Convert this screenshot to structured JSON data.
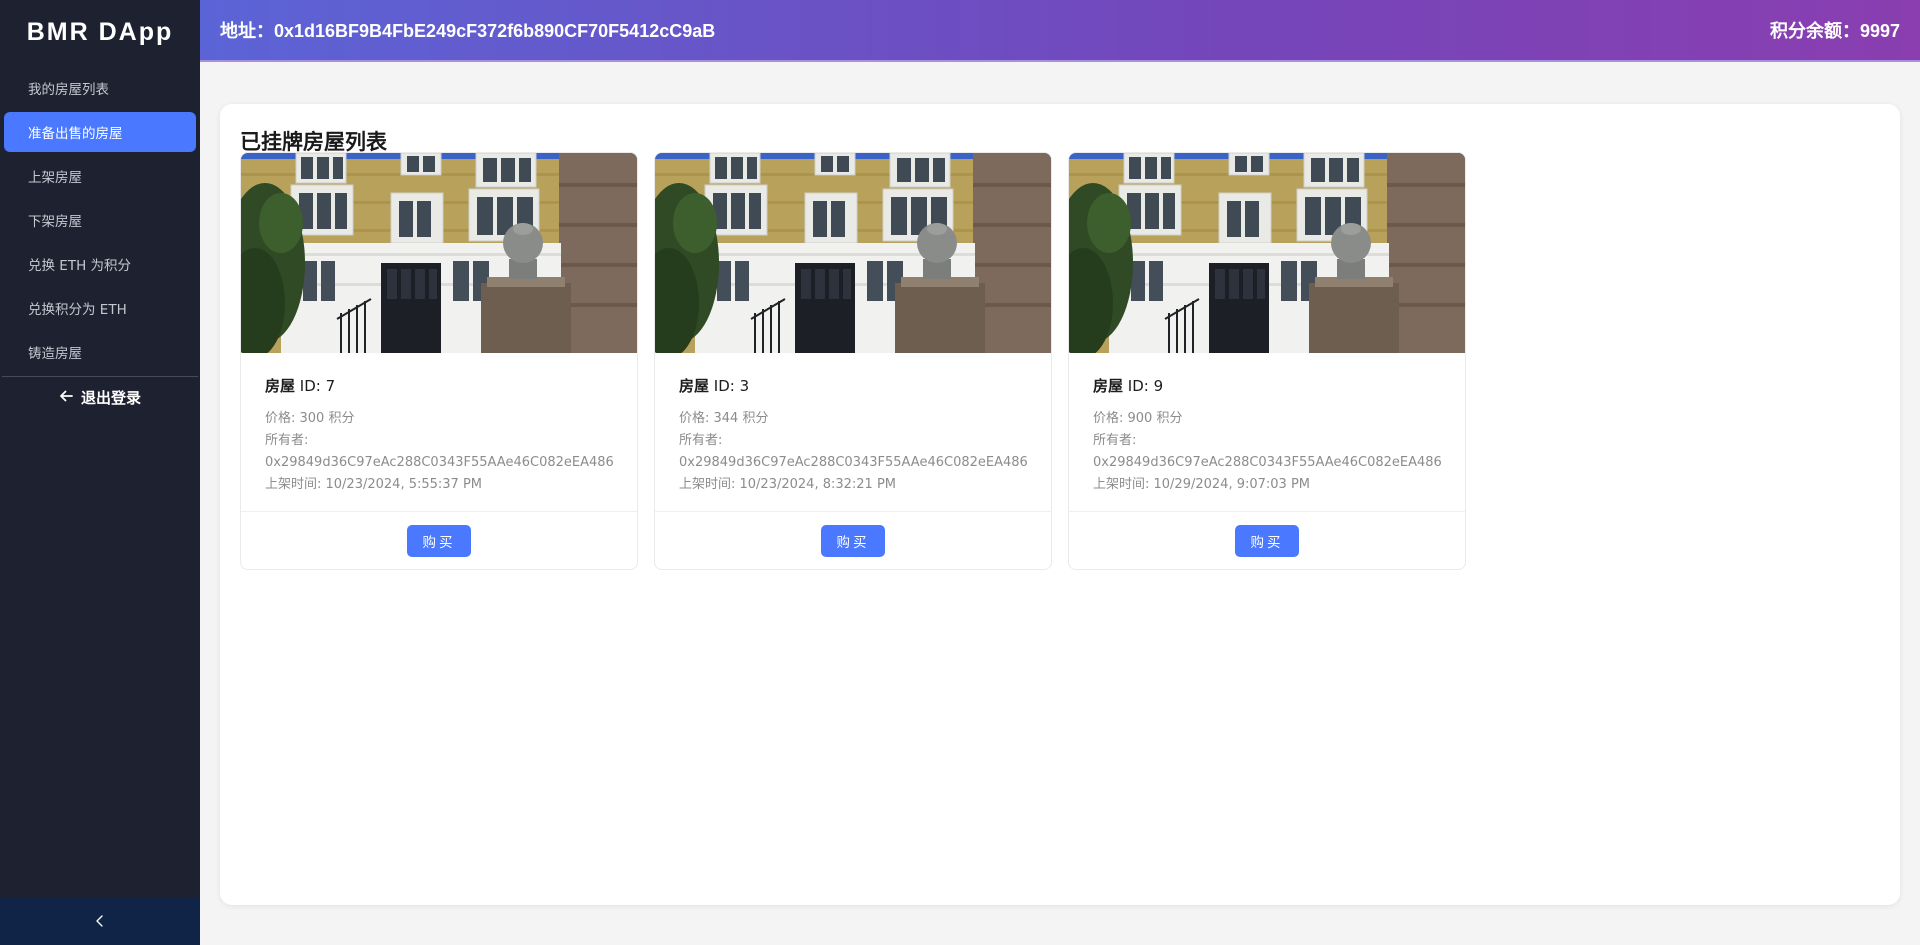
{
  "sidebar": {
    "logo": "BMR DApp",
    "items": [
      {
        "label": "我的房屋列表",
        "active": false
      },
      {
        "label": "准备出售的房屋",
        "active": true
      },
      {
        "label": "上架房屋",
        "active": false
      },
      {
        "label": "下架房屋",
        "active": false
      },
      {
        "label": "兑换 ETH 为积分",
        "active": false
      },
      {
        "label": "兑换积分为 ETH",
        "active": false
      },
      {
        "label": "铸造房屋",
        "active": false
      }
    ],
    "logout_label": "退出登录",
    "logout_icon": "arrow-left-icon",
    "collapse_icon": "chevron-left-icon"
  },
  "header": {
    "address": "地址：0x1d16BF9B4FbE249cF372f6b890CF70F5412cC9aB",
    "balance": "积分余额：9997"
  },
  "main": {
    "title": "已挂牌房屋列表",
    "cards": [
      {
        "title_prefix": "房屋",
        "id_text": " ID: 7",
        "price": "价格: 300 积分",
        "owner_label": "所有者:",
        "owner": "0x29849d36C97eAc288C0343F55AAe46C082eEA486",
        "listed_time": "上架时间: 10/23/2024, 5:55:37 PM",
        "buy_label": "购买"
      },
      {
        "title_prefix": "房屋",
        "id_text": " ID: 3",
        "price": "价格: 344 积分",
        "owner_label": "所有者:",
        "owner": "0x29849d36C97eAc288C0343F55AAe46C082eEA486",
        "listed_time": "上架时间: 10/23/2024, 8:32:21 PM",
        "buy_label": "购买"
      },
      {
        "title_prefix": "房屋",
        "id_text": " ID: 9",
        "price": "价格: 900 积分",
        "owner_label": "所有者:",
        "owner": "0x29849d36C97eAc288C0343F55AAe46C082eEA486",
        "listed_time": "上架时间: 10/29/2024, 9:07:03 PM",
        "buy_label": "购买"
      }
    ]
  },
  "colors": {
    "sidebar_bg": "#1e2130",
    "accent": "#4a78ff",
    "header_gradient_start": "#5b64d6",
    "header_gradient_end": "#8a3eb0"
  }
}
